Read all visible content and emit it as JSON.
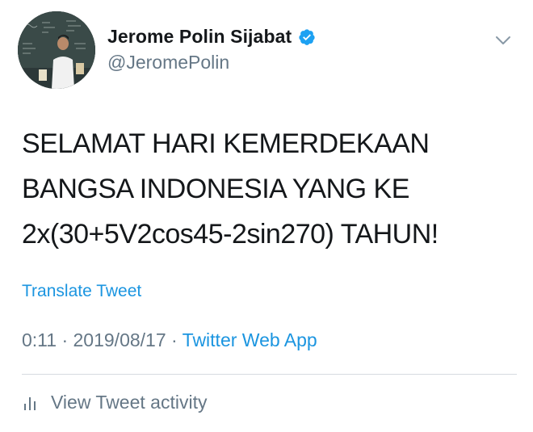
{
  "user": {
    "display_name": "Jerome Polin Sijabat",
    "handle": "@JeromePolin",
    "verified": true,
    "avatar_icon": "avatar"
  },
  "tweet": {
    "lines": [
      "SELAMAT HARI KEMERDEKAAN",
      "BANGSA INDONESIA YANG KE",
      "2x(30+5V2cos45-2sin270) TAHUN!"
    ]
  },
  "translate_label": "Translate Tweet",
  "meta": {
    "time": "0:11",
    "separator": " · ",
    "date": "2019/08/17",
    "source": "Twitter Web App"
  },
  "activity_label": "View Tweet activity",
  "icons": {
    "verified": "verified-badge-icon",
    "menu": "chevron-down-icon",
    "activity": "bar-chart-icon"
  },
  "colors": {
    "text": "#14171a",
    "muted": "#657786",
    "link": "#1b95e0",
    "verified": "#1da1f2"
  }
}
